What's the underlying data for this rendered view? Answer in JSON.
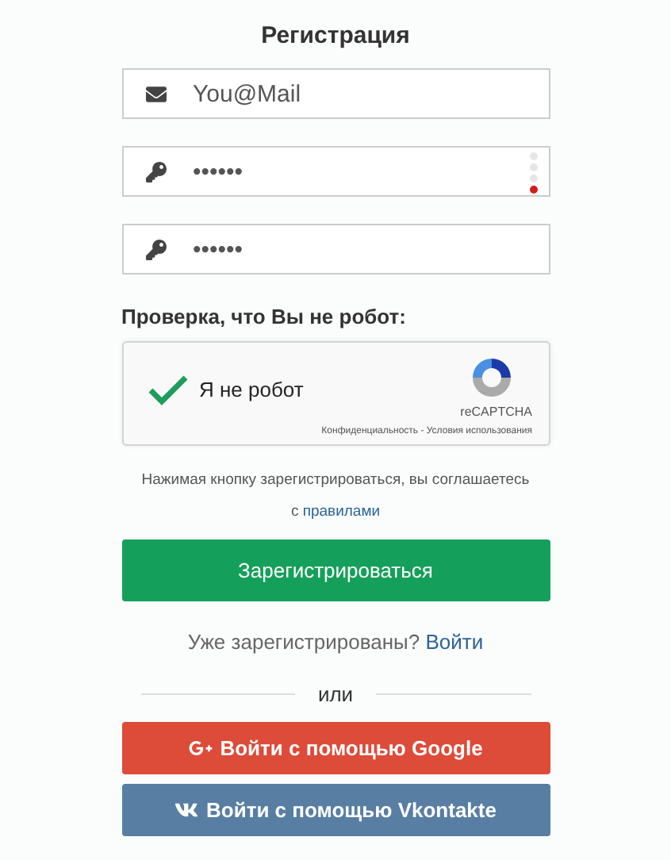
{
  "title": "Регистрация",
  "fields": [
    {
      "kind": "email",
      "value": "You@Mail"
    },
    {
      "kind": "password",
      "value": "••••••",
      "strength": {
        "level": 0.25
      }
    },
    {
      "kind": "password",
      "value": "••••••"
    }
  ],
  "captcha": {
    "label": "Проверка, что Вы не робот:",
    "text": "Я не робот",
    "checked": true,
    "brand": "reCAPTCHA",
    "privacy": "Конфиденциальность",
    "separator": " - ",
    "terms": "Условия использования"
  },
  "agreement": {
    "text": "Нажимая кнопку зарегистрироваться, вы соглашаетесь",
    "prefix": "с",
    "link": "правилами"
  },
  "submit": "Зарегистрироваться",
  "login": {
    "text": "Уже зарегистрированы?",
    "link": "Войти"
  },
  "divider": "или",
  "social": [
    {
      "kind": "google",
      "label": "Войти с помощью Google"
    },
    {
      "kind": "vk",
      "label": "Войти с помощью Vkontakte"
    }
  ]
}
